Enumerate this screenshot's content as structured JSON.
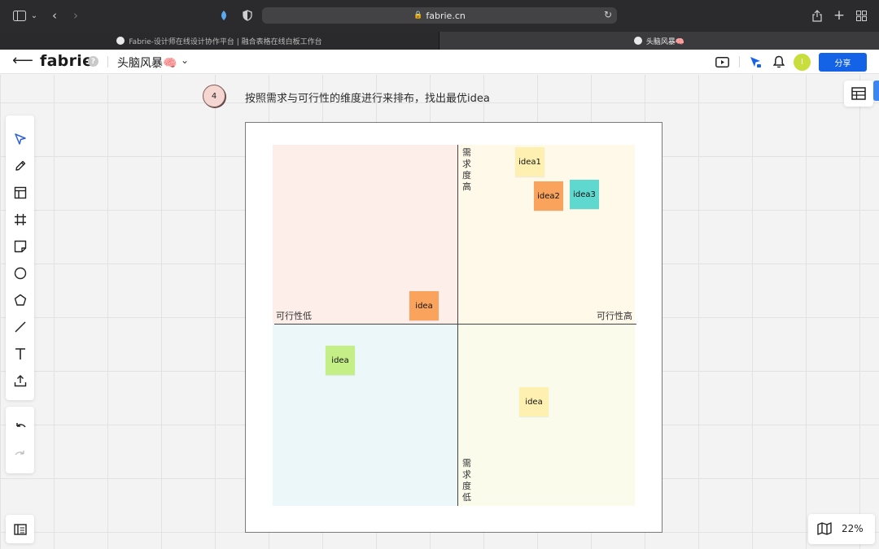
{
  "browser": {
    "url": "fabrie.cn",
    "tabs": [
      {
        "label": "Fabrie-设计师在线设计协作平台 | 融合表格在线白板工作台"
      },
      {
        "label": "头脑风暴🧠"
      }
    ]
  },
  "header": {
    "logo": "fabrie",
    "help": "?",
    "doc_title": "头脑风暴🧠",
    "avatar_initial": "I",
    "share_label": "分享"
  },
  "canvas": {
    "step_number": "4",
    "step_text": "按照需求与可行性的维度进行来排布，找出最优idea",
    "matrix": {
      "top_label": "需求度高",
      "bottom_label": "需求度低",
      "left_label": "可行性低",
      "right_label": "可行性高"
    },
    "stickies": [
      {
        "text": "idea1",
        "color": "#fdf0b0"
      },
      {
        "text": "idea2",
        "color": "#f9a35c"
      },
      {
        "text": "idea3",
        "color": "#5fd9d0"
      },
      {
        "text": "idea",
        "color": "#f9a35c"
      },
      {
        "text": "idea",
        "color": "#c4ef87"
      },
      {
        "text": "idea",
        "color": "#fdf0b0"
      }
    ],
    "zoom": "22%"
  },
  "colors": {
    "accent": "#1463e6",
    "tool_active": "#2c5fe0"
  }
}
